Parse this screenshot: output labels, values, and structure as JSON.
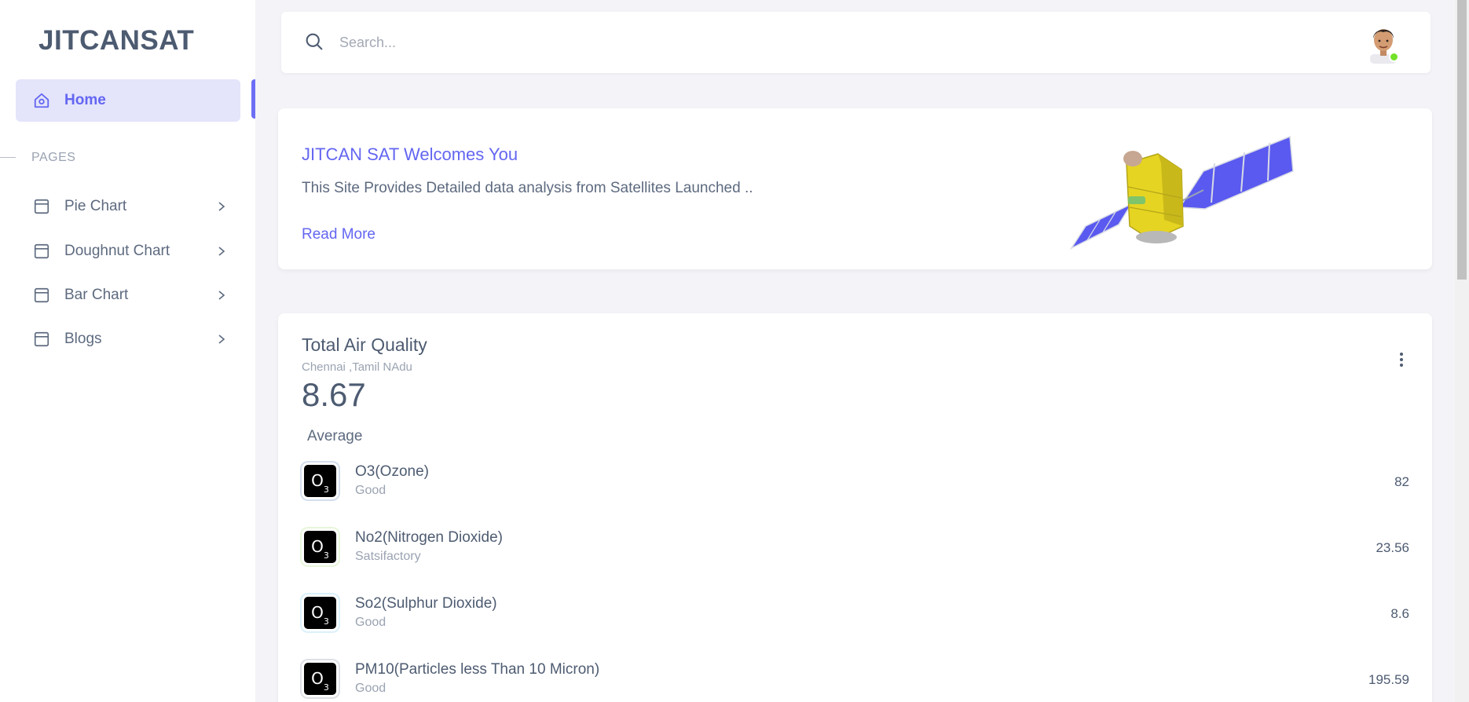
{
  "brand": "JITCANSAT",
  "sidebar": {
    "home_label": "Home",
    "section_label": "PAGES",
    "items": [
      {
        "label": "Pie Chart"
      },
      {
        "label": "Doughnut Chart"
      },
      {
        "label": "Bar Chart"
      },
      {
        "label": "Blogs"
      }
    ]
  },
  "search": {
    "placeholder": "Search..."
  },
  "welcome": {
    "title": "JITCAN SAT Welcomes You",
    "text": "This Site Provides Detailed data analysis from Satellites Launched ..",
    "link": "Read More"
  },
  "air_quality": {
    "title": "Total Air Quality",
    "subtitle": "Chennai ,Tamil NAdu",
    "value": "8.67",
    "average_label": "Average",
    "pollutants": [
      {
        "name": "O3(Ozone)",
        "status": "Good",
        "value": "82",
        "ring_color": "#7a9cc6"
      },
      {
        "name": "No2(Nitrogen Dioxide)",
        "status": "Satsifactory",
        "value": "23.56",
        "ring_color": "#b7e58f"
      },
      {
        "name": "So2(Sulphur Dioxide)",
        "status": "Good",
        "value": "8.6",
        "ring_color": "#8fd3ee"
      },
      {
        "name": "PM10(Particles less Than 10 Micron)",
        "status": "Good",
        "value": "195.59",
        "ring_color": "#9aa3b2"
      }
    ],
    "icon_symbol": "O",
    "icon_subscript": "3"
  },
  "colors": {
    "primary": "#6366f1",
    "active_bg": "#e4e4fb",
    "online": "#72e128"
  },
  "icons": {
    "home": "home-icon",
    "page": "layout-icon",
    "chevron": "chevron-right-icon",
    "search": "search-icon",
    "more": "dots-vertical-icon"
  }
}
